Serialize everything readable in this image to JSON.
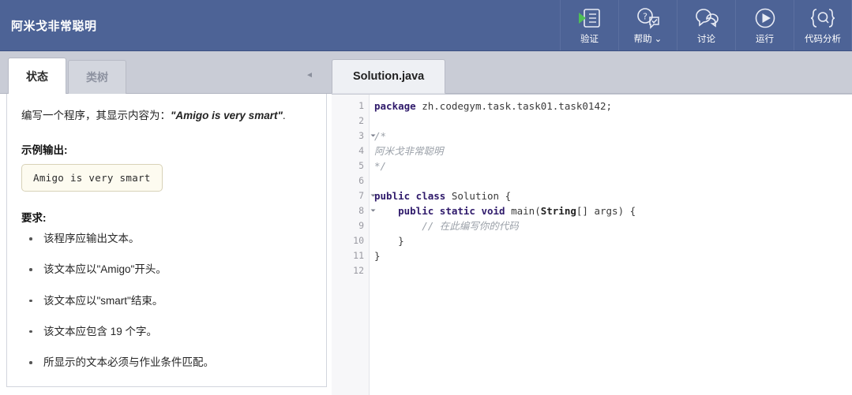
{
  "header": {
    "brand_title": "阿米戈非常聪明",
    "tools": [
      {
        "label": "验证",
        "icon": "verify-checklist-play-icon",
        "has_caret": false
      },
      {
        "label": "帮助",
        "icon": "help-question-chat-icon",
        "has_caret": true,
        "caret": "⌄"
      },
      {
        "label": "讨论",
        "icon": "discussion-bubbles-icon",
        "has_caret": false
      },
      {
        "label": "运行",
        "icon": "run-play-circle-icon",
        "has_caret": false
      },
      {
        "label": "代码分析",
        "icon": "code-analysis-braces-icon",
        "has_caret": false
      }
    ],
    "bg_color": "#4d6396"
  },
  "left_panel": {
    "tabs": [
      {
        "label": "状态",
        "active": true
      },
      {
        "label": "类树",
        "active": false
      }
    ],
    "collapse_icon": "chevron-left-icon",
    "collapse_glyph": "◄",
    "intro_prefix": "编写一个程序，其显示内容为：",
    "intro_quote": "\"Amigo is very smart\"",
    "intro_suffix": ".",
    "example_heading": "示例输出:",
    "example_output": "Amigo is very smart",
    "requirements_heading": "要求:",
    "requirements": [
      "该程序应输出文本。",
      "该文本应以\"Amigo\"开头。",
      "该文本应以\"smart\"结束。",
      "该文本应包含 19 个字。",
      "所显示的文本必须与作业条件匹配。"
    ]
  },
  "editor": {
    "tab_label": "Solution.java",
    "line_numbers": [
      "1",
      "2",
      "3",
      "4",
      "5",
      "6",
      "7",
      "8",
      "9",
      "10",
      "11",
      "12"
    ],
    "fold_lines": [
      3,
      7,
      8
    ],
    "code_lines": [
      {
        "n": 1,
        "segments": [
          {
            "t": "package",
            "c": "kw"
          },
          {
            "t": " zh.codegym.task.task01.task0142;",
            "c": "pl"
          }
        ]
      },
      {
        "n": 2,
        "segments": [
          {
            "t": "",
            "c": "pl"
          }
        ]
      },
      {
        "n": 3,
        "segments": [
          {
            "t": "/*",
            "c": "cm"
          }
        ]
      },
      {
        "n": 4,
        "segments": [
          {
            "t": "阿米戈非常聪明",
            "c": "cm"
          }
        ]
      },
      {
        "n": 5,
        "segments": [
          {
            "t": "*/",
            "c": "cm"
          }
        ]
      },
      {
        "n": 6,
        "segments": [
          {
            "t": "",
            "c": "pl"
          }
        ]
      },
      {
        "n": 7,
        "segments": [
          {
            "t": "public class",
            "c": "kw"
          },
          {
            "t": " Solution {",
            "c": "pl"
          }
        ]
      },
      {
        "n": 8,
        "segments": [
          {
            "t": "    ",
            "c": "pl"
          },
          {
            "t": "public static void",
            "c": "kw"
          },
          {
            "t": " main(",
            "c": "pl"
          },
          {
            "t": "String",
            "c": "ty"
          },
          {
            "t": "[] args) {",
            "c": "pl"
          }
        ]
      },
      {
        "n": 9,
        "segments": [
          {
            "t": "        ",
            "c": "pl"
          },
          {
            "t": "// 在此编写你的代码",
            "c": "cm"
          }
        ]
      },
      {
        "n": 10,
        "segments": [
          {
            "t": "    }",
            "c": "pl"
          }
        ]
      },
      {
        "n": 11,
        "segments": [
          {
            "t": "}",
            "c": "pl"
          }
        ]
      },
      {
        "n": 12,
        "segments": [
          {
            "t": "",
            "c": "pl"
          }
        ]
      }
    ]
  }
}
